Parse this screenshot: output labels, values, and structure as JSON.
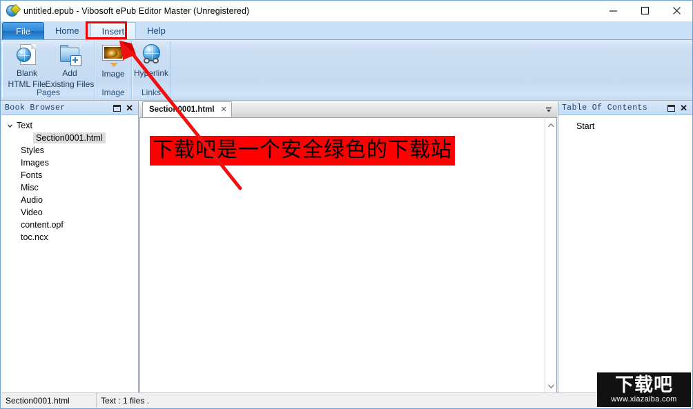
{
  "window": {
    "title": "untitled.epub - Vibosoft ePub Editor Master (Unregistered)",
    "app_icon": "epub-editor-icon",
    "controls": {
      "minimize": "minimize-icon",
      "maximize": "maximize-icon",
      "close": "close-icon"
    }
  },
  "ribbon": {
    "tabs": [
      {
        "label": "File",
        "id": "file"
      },
      {
        "label": "Home",
        "id": "home"
      },
      {
        "label": "Insert",
        "id": "insert"
      },
      {
        "label": "Help",
        "id": "help"
      }
    ],
    "active_tab": "Insert",
    "highlight_color": "#ee0000",
    "groups": [
      {
        "name": "Pages",
        "buttons": [
          {
            "label_line1": "Blank",
            "label_line2": "HTML File",
            "icon": "blank-html-file-icon"
          },
          {
            "label_line1": "Add",
            "label_line2": "Existing Files",
            "icon": "add-existing-files-icon"
          }
        ]
      },
      {
        "name": "Image",
        "buttons": [
          {
            "label_line1": "Image",
            "label_line2": "",
            "icon": "insert-image-icon",
            "has_dropdown": true
          }
        ]
      },
      {
        "name": "Links",
        "buttons": [
          {
            "label_line1": "Hyperlink",
            "label_line2": "",
            "icon": "hyperlink-icon"
          }
        ]
      }
    ]
  },
  "book_browser": {
    "title": "Book Browser",
    "float_icon": "float-panel-icon",
    "close_icon": "close-panel-icon",
    "tree": [
      {
        "label": "Text",
        "level": 0,
        "expanded": true,
        "selected": false
      },
      {
        "label": "Section0001.html",
        "level": 1,
        "expanded": null,
        "selected": true
      },
      {
        "label": "Styles",
        "level": 0,
        "expanded": null,
        "selected": false
      },
      {
        "label": "Images",
        "level": 0,
        "expanded": null,
        "selected": false
      },
      {
        "label": "Fonts",
        "level": 0,
        "expanded": null,
        "selected": false
      },
      {
        "label": "Misc",
        "level": 0,
        "expanded": null,
        "selected": false
      },
      {
        "label": "Audio",
        "level": 0,
        "expanded": null,
        "selected": false
      },
      {
        "label": "Video",
        "level": 0,
        "expanded": null,
        "selected": false
      },
      {
        "label": "content.opf",
        "level": 0,
        "expanded": null,
        "selected": false
      },
      {
        "label": "toc.ncx",
        "level": 0,
        "expanded": null,
        "selected": false
      }
    ]
  },
  "editor": {
    "tab": {
      "name": "Section0001.html",
      "close_icon": "close-tab-icon"
    },
    "tablist_icon": "tab-list-dropdown-icon",
    "content_text": "下载吧是一个安全绿色的下载站",
    "content_highlight_color": "#ff0000",
    "content_text_color": "#000000",
    "scrollbar": {
      "up_icon": "scroll-up-icon",
      "down_icon": "scroll-down-icon"
    }
  },
  "table_of_contents": {
    "title": "Table Of Contents",
    "float_icon": "float-panel-icon",
    "close_icon": "close-panel-icon",
    "items": [
      {
        "label": "Start"
      }
    ]
  },
  "statusbar": {
    "file_name": "Section0001.html",
    "file_count": "Text : 1 files ."
  },
  "watermark": {
    "brand": "下载吧",
    "url": "www.xiazaiba.com"
  }
}
